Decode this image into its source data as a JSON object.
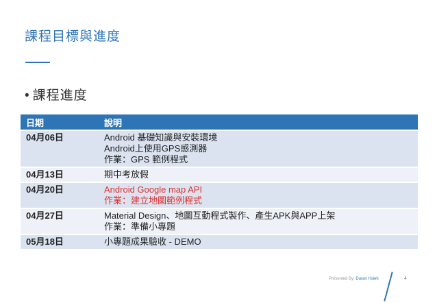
{
  "slide": {
    "title": "課程目標與進度",
    "bullet": "課程進度"
  },
  "table": {
    "headers": [
      "日期",
      "說明"
    ],
    "rows": [
      {
        "date": "04月06日",
        "lines": [
          "Android 基礎知識與安裝環境",
          "Android上使用GPS感測器",
          "作業：GPS 範例程式"
        ],
        "highlight": false
      },
      {
        "date": "04月13日",
        "lines": [
          "期中考放假"
        ],
        "highlight": false
      },
      {
        "date": "04月20日",
        "lines": [
          "Android Google map API",
          "作業：建立地圖範例程式"
        ],
        "highlight": true
      },
      {
        "date": "04月27日",
        "lines": [
          "Material Design、地圖互動程式製作、產生APK與APP上架",
          "作業：準備小專題"
        ],
        "highlight": false
      },
      {
        "date": "05月18日",
        "lines": [
          "小專題成果驗收 - DEMO"
        ],
        "highlight": false
      }
    ]
  },
  "footer": {
    "presented_by": "Presented By:",
    "presenter": "Duran Hsieh",
    "page_number": "4"
  },
  "colors": {
    "accent": "#2e75b6",
    "highlight_text": "#e03030"
  }
}
